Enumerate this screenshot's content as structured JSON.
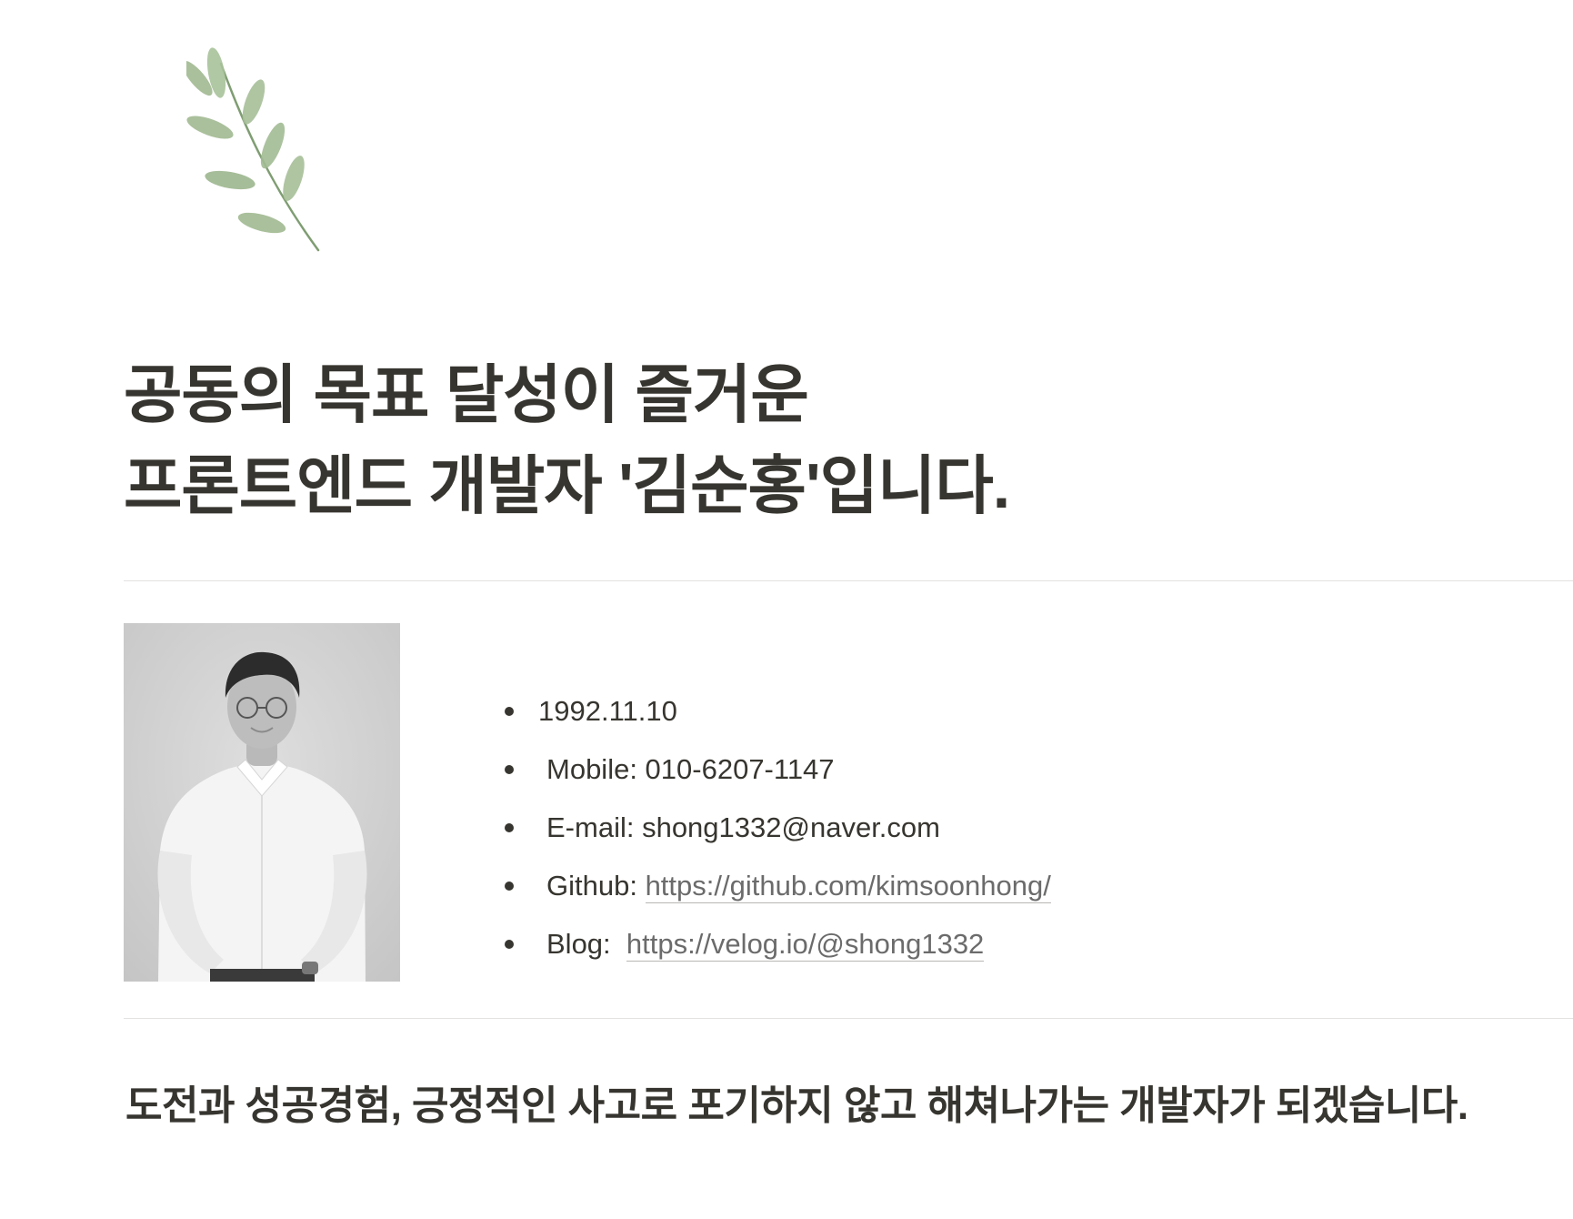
{
  "icon": {
    "name": "leaf-branch-icon",
    "color": "#9bb58b",
    "stem_color": "#7f9d72"
  },
  "title": {
    "line1": "공동의 목표 달성이 즐거운",
    "line2": "프론트엔드 개발자 '김순홍'입니다."
  },
  "profile": {
    "photo_icon": "portrait-photo",
    "info": [
      {
        "text": "1992.11.10"
      },
      {
        "label": "Mobile: ",
        "value": "010-6207-1147"
      },
      {
        "label": "E-mail: ",
        "value": "shong1332@naver.com"
      },
      {
        "label": "Github: ",
        "link": "https://github.com/kimsoonhong/"
      },
      {
        "label": "Blog:  ",
        "link": "https://velog.io/@shong1332"
      }
    ]
  },
  "tagline": "도전과 성공경험, 긍정적인 사고로 포기하지 않고 해쳐나가는 개발자가 되겠습니다."
}
